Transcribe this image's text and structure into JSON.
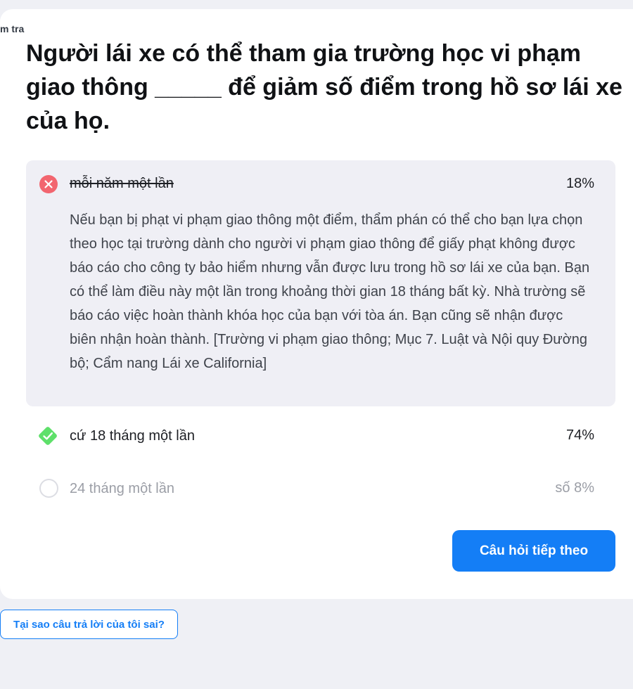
{
  "breadcrumb": "m tra",
  "question": "Người lái xe có thể tham gia trường học vi phạm giao thông _____ để giảm số điểm trong hồ sơ lái xe của họ.",
  "options": [
    {
      "label": "mỗi năm một lần",
      "percent": "18%",
      "state": "wrong",
      "icon": "close-circle-icon",
      "explanation": "Nếu bạn bị phạt vi phạm giao thông một điểm, thẩm phán có thể cho bạn lựa chọn theo học tại trường dành cho người vi phạm giao thông để giấy phạt không được báo cáo cho công ty bảo hiểm nhưng vẫn được lưu trong hồ sơ lái xe của bạn. Bạn có thể làm điều này một lần trong khoảng thời gian 18 tháng bất kỳ. Nhà trường sẽ báo cáo việc hoàn thành khóa học của bạn với tòa án. Bạn cũng sẽ nhận được biên nhận hoàn thành. [Trường vi phạm giao thông; Mục 7. Luật và Nội quy Đường bộ; Cẩm nang Lái xe California]"
    },
    {
      "label": "cứ 18 tháng một lần",
      "percent": "74%",
      "state": "correct",
      "icon": "check-diamond-icon"
    },
    {
      "label": "24 tháng một lần",
      "percent": "số 8%",
      "state": "unselected",
      "icon": "empty-circle-icon"
    }
  ],
  "buttons": {
    "next": "Câu hỏi tiếp theo",
    "why_wrong": "Tại sao câu trả lời của tôi sai?"
  },
  "colors": {
    "accent": "#147ef6",
    "wrong": "#f2656f",
    "correct": "#5ee06a",
    "wrong_bg": "#efeff5",
    "page_bg": "#eff0f5"
  }
}
